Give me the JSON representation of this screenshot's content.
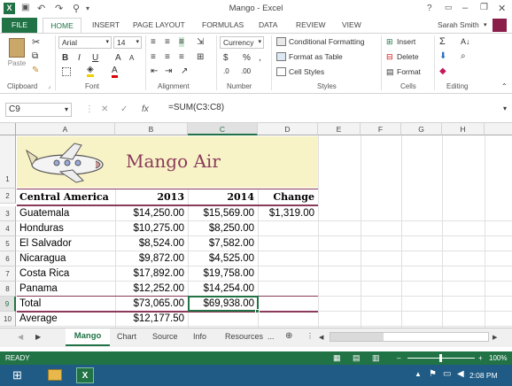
{
  "app": {
    "title": "Mango - Excel",
    "user": "Sarah Smith",
    "help": "?"
  },
  "tabs": [
    "FILE",
    "HOME",
    "INSERT",
    "PAGE LAYOUT",
    "FORMULAS",
    "DATA",
    "REVIEW",
    "VIEW"
  ],
  "ribbon": {
    "clipboard": {
      "label": "Clipboard",
      "paste": "Paste"
    },
    "font": {
      "label": "Font",
      "name": "Arial",
      "size": "14",
      "bold": "B",
      "italic": "I",
      "underline": "U",
      "grow": "A",
      "shrink": "A",
      "color_letter": "A"
    },
    "alignment": {
      "label": "Alignment"
    },
    "number": {
      "label": "Number",
      "format": "Currency",
      "dollar": "$",
      "percent": "%",
      "comma": ","
    },
    "styles": {
      "label": "Styles",
      "conditional": "Conditional Formatting",
      "table": "Format as Table",
      "cell_styles": "Cell Styles"
    },
    "cells": {
      "label": "Cells",
      "insert": "Insert",
      "delete": "Delete",
      "format": "Format"
    },
    "editing": {
      "label": "Editing"
    }
  },
  "formula_bar": {
    "cell": "C9",
    "fx": "fx",
    "formula": "=SUM(C3:C8)"
  },
  "columns": [
    "A",
    "B",
    "C",
    "D",
    "E",
    "F",
    "G",
    "H"
  ],
  "rows": [
    "1",
    "2",
    "3",
    "4",
    "5",
    "6",
    "7",
    "8",
    "9",
    "10"
  ],
  "sheet": {
    "title": "Mango Air",
    "headers": [
      "Central America",
      "2013",
      "2014",
      "Change"
    ],
    "data": [
      [
        "Guatemala",
        "$14,250.00",
        "$15,569.00",
        "$1,319.00"
      ],
      [
        "Honduras",
        "$10,275.00",
        "$8,250.00",
        ""
      ],
      [
        "El Salvador",
        "$8,524.00",
        "$7,582.00",
        ""
      ],
      [
        "Nicaragua",
        "$9,872.00",
        "$4,525.00",
        ""
      ],
      [
        "Costa Rica",
        "$17,892.00",
        "$19,758.00",
        ""
      ],
      [
        "Panama",
        "$12,252.00",
        "$14,254.00",
        ""
      ],
      [
        "Total",
        "$73,065.00",
        "$69,938.00",
        ""
      ],
      [
        "Average",
        "$12,177.50",
        "",
        ""
      ]
    ]
  },
  "sheet_tabs": [
    "Mango",
    "Chart",
    "Source",
    "Info",
    "Resources",
    "..."
  ],
  "status": {
    "ready": "READY",
    "zoom": "100%"
  },
  "taskbar": {
    "time": "2:08 PM"
  },
  "colors": {
    "excel_green": "#217346",
    "sheet_title_bg": "#f8f3c7",
    "title_text": "#8a3a5a",
    "taskbar": "#1f5b85"
  }
}
